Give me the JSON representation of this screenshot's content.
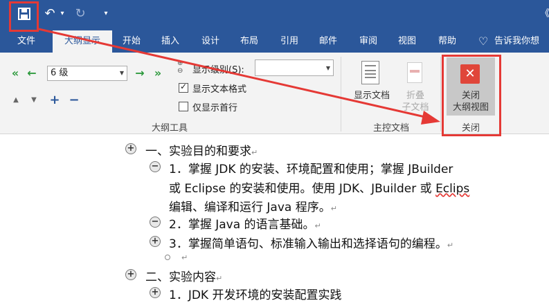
{
  "quick_access": {
    "save_icon": "save-icon",
    "undo_icon": "undo-icon",
    "redo_icon": "redo-icon",
    "more": "▾",
    "restore": "《"
  },
  "tabs": [
    "文件",
    "大纲显示",
    "开始",
    "插入",
    "设计",
    "布局",
    "引用",
    "邮件",
    "审阅",
    "视图",
    "帮助"
  ],
  "tell_me": "告诉我你想",
  "outline_tools": {
    "level_value": "6 级",
    "show_level_label": "显示级别(S):",
    "show_level_value": "",
    "show_text_format": "显示文本格式",
    "show_text_format_checked": true,
    "show_first_line": "仅显示首行",
    "show_first_line_checked": false,
    "group_label": "大纲工具"
  },
  "master_doc": {
    "show_doc": "显示文档",
    "collapse_l1": "折叠",
    "collapse_l2": "子文档",
    "group_label": "主控文档"
  },
  "close": {
    "btn_l1": "关闭",
    "btn_l2": "大纲视图",
    "group_label": "关闭"
  },
  "document": {
    "lines": [
      "一、实验目的和要求",
      "1．掌握 JDK 的安装、环境配置和使用；掌握 JBuilder",
      "或 Eclipse 的安装和使用。使用 JDK、JBuilder 或 ",
      "Eclips",
      "编辑、编译和运行 Java 程序。",
      "2．掌握 Java 的语言基础。",
      "3．掌握简单语句、标准输入输出和选择语句的编程。",
      "二、实验内容",
      "1．JDK 开发环境的安装配置实践"
    ],
    "return_mark": "↵"
  },
  "colors": {
    "accent": "#2b579a",
    "annotation": "#e53935"
  }
}
